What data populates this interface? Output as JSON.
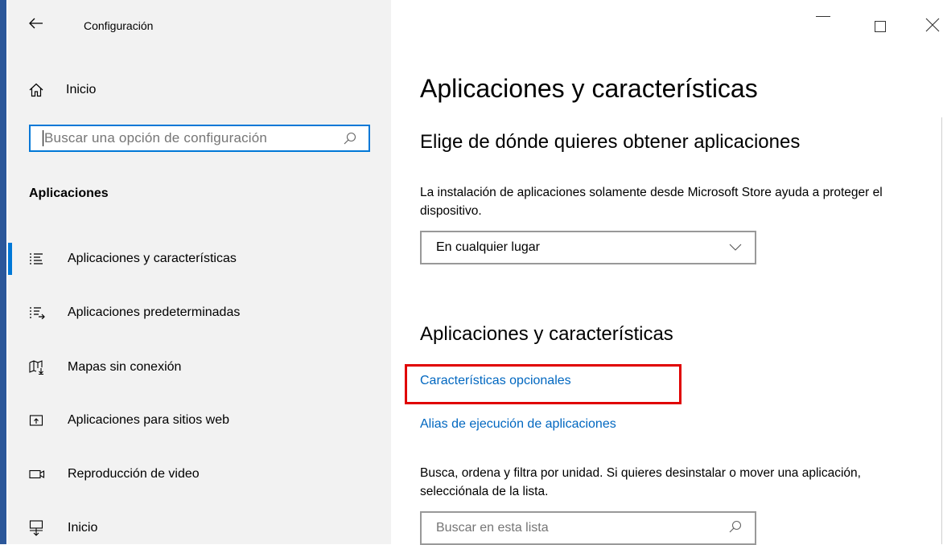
{
  "window": {
    "title": "Configuración"
  },
  "sidebar": {
    "home_label": "Inicio",
    "search_placeholder": "Buscar una opción de configuración",
    "section_header": "Aplicaciones",
    "items": [
      {
        "label": "Aplicaciones y características",
        "icon": "apps-list-icon",
        "active": true
      },
      {
        "label": "Aplicaciones predeterminadas",
        "icon": "default-apps-icon"
      },
      {
        "label": "Mapas sin conexión",
        "icon": "map-download-icon"
      },
      {
        "label": "Aplicaciones para sitios web",
        "icon": "web-app-icon"
      },
      {
        "label": "Reproducción de video",
        "icon": "video-icon"
      },
      {
        "label": "Inicio",
        "icon": "startup-icon"
      }
    ]
  },
  "main": {
    "title": "Aplicaciones y características",
    "source_heading": "Elige de dónde quieres obtener aplicaciones",
    "source_description": "La instalación de aplicaciones solamente desde Microsoft Store ayuda a proteger el dispositivo.",
    "source_dropdown_value": "En cualquier lugar",
    "apps_heading": "Aplicaciones y características",
    "link_optional_features": "Características opcionales",
    "link_app_aliases": "Alias de ejecución de aplicaciones",
    "list_description": "Busca, ordena y filtra por unidad. Si quieres desinstalar o mover una aplicación, selecciónala de la lista.",
    "list_search_placeholder": "Buscar en esta lista"
  },
  "colors": {
    "accent": "#0078d7",
    "link": "#0067c0",
    "highlight": "#e00000",
    "sidebar_bg": "#f2f2f2"
  }
}
